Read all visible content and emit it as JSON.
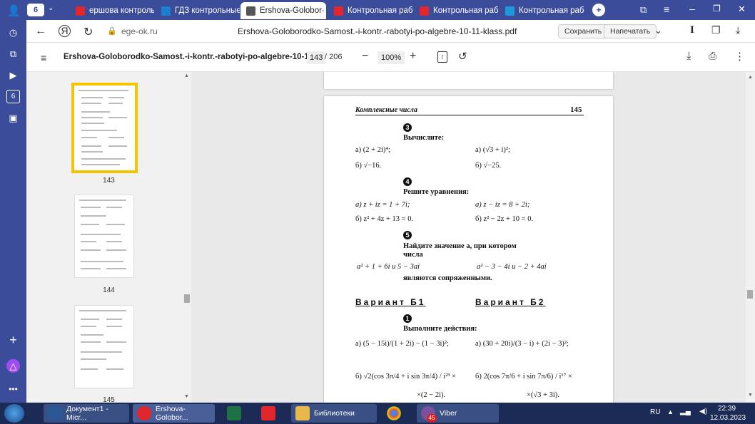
{
  "tabs": [
    {
      "label": "6",
      "kind": "counter"
    },
    {
      "label": "ершова контрольн",
      "color": "#e3262c"
    },
    {
      "label": "ГДЗ контрольные р",
      "color": "#1e7fd0"
    },
    {
      "label": "Ershova-Golobor·",
      "color": "#555555",
      "active": true
    },
    {
      "label": "Контрольная рабо",
      "color": "#e3262c"
    },
    {
      "label": "Контрольная рабо",
      "color": "#e3262c"
    },
    {
      "label": "Контрольная рабо",
      "color": "#1a9ad8"
    }
  ],
  "address": {
    "domain": "ege-ok.ru",
    "title": "Ershova-Goloborodko-Samost.-i-kontr.-rabotyi-po-algebre-10-11-klass.pdf",
    "save_label": "Сохранить",
    "print_label": "Напечатать"
  },
  "pdf": {
    "filename": "Ershova-Goloborodko-Samost.-i-kontr.-rabotyi-po-algebre-10-1...",
    "page_current": "143",
    "page_total": "/ 206",
    "zoom": "100%"
  },
  "thumbs": [
    "143",
    "144",
    "145"
  ],
  "page": {
    "header": "Комплексные числа",
    "pagenum": "145",
    "q3": {
      "num": "3",
      "title": "Вычислите:",
      "a1": "а)  (2 + 2i)⁴;",
      "a2": "а)  (√3 + i)²;",
      "b1": "б)  √−16.",
      "b2": "б)  √−25."
    },
    "q4": {
      "num": "4",
      "title": "Решите уравнения:",
      "a1": "а)  z + iz = 1 + 7i;",
      "a2": "а)  z − iz = 8 + 2i;",
      "b1": "б)  z² + 4z + 13 = 0.",
      "b2": "б)  z² − 2z + 10 = 0."
    },
    "q5": {
      "num": "5",
      "title1": "Найдите значение a, при котором",
      "title2": "числа",
      "e1": "a² + 1 + 6i  и  5 − 3ai",
      "e2": "a² − 3 − 4i  и  − 2 + 4ai",
      "tail": "являются сопряженными."
    },
    "variant1": "Вариант Б1",
    "variant2": "Вариант Б2",
    "q1": {
      "num": "1",
      "title": "Выполните действия:",
      "a1": "а)  (5 − 15i)/(1 + 2i) − (1 − 3i)²;",
      "a2": "а)  (30 + 20i)/(3 − i) + (2i − 3)²;",
      "b1": "б)  √2(cos 3π/4 + i sin 3π/4) / i²³ ×",
      "b2": "б)  2(cos 7π/6 + i sin 7π/6) / i¹⁷ ×",
      "c1": "×(2 − 2i).",
      "c2": "×(√3 + 3i)."
    }
  },
  "taskbar": {
    "items": [
      {
        "label": "Документ1 - Micr...",
        "color": "#2b5797"
      },
      {
        "label": "Ershova-Golobor...",
        "color": "#e3262c"
      },
      {
        "label": "",
        "color": "#1e7145"
      },
      {
        "label": "",
        "color": "#e3262c"
      },
      {
        "label": "Библиотеки",
        "color": "#e8b84a"
      },
      {
        "label": "",
        "color": "#dd4b39"
      },
      {
        "label": "Viber",
        "color": "#7b519d"
      }
    ],
    "badge": "45",
    "lang": "RU",
    "time": "22:39",
    "date": "12.03.2023"
  }
}
